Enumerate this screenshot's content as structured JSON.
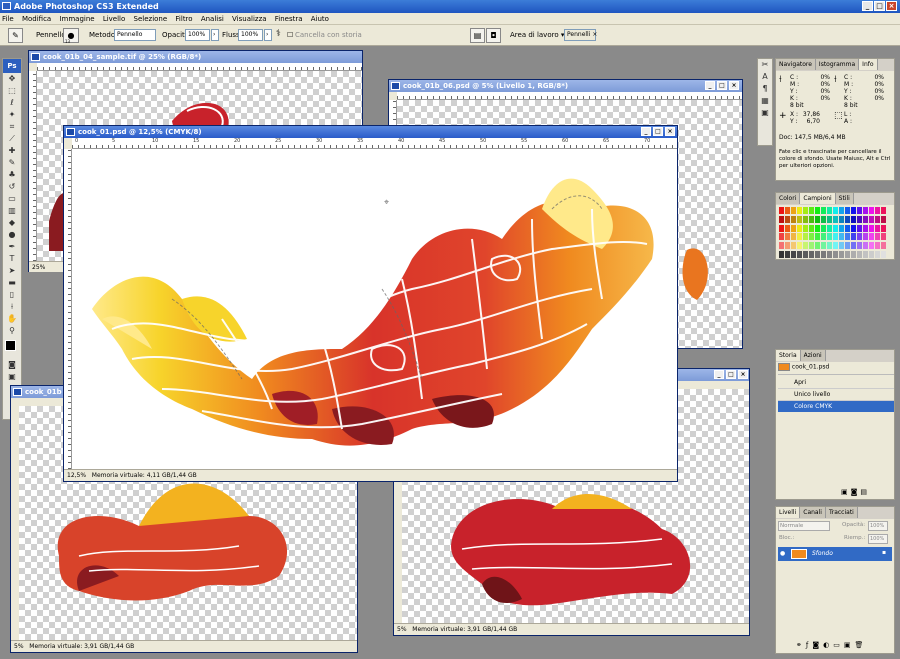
{
  "app": {
    "title": "Adobe Photoshop CS3 Extended"
  },
  "menu": [
    "File",
    "Modifica",
    "Immagine",
    "Livello",
    "Selezione",
    "Filtro",
    "Analisi",
    "Visualizza",
    "Finestra",
    "Aiuto"
  ],
  "options": {
    "brush_label": "Pennello:",
    "brush_size": "13",
    "method_label": "Metodo:",
    "method_value": "Pennello",
    "opacity_label": "Opacità:",
    "opacity_value": "100%",
    "flow_label": "Flusso:",
    "flow_value": "100%",
    "erase_history": "Cancella con storia",
    "workspace": "Area di lavoro",
    "brushes_tab": "Pennelli"
  },
  "documents": [
    {
      "title": "cook_01b_04_sample.tif @ 25% (RGB/8*)",
      "zoom": "25%"
    },
    {
      "title": "cook_01b_06.psd @ 5% (Livello 1, RGB/8*)",
      "zoom": ""
    },
    {
      "title": "cook_01.psd @ 12,5% (CMYK/8)",
      "zoom": "12,5%",
      "status": "Memoria virtuale: 4,11 GB/1,44 GB"
    },
    {
      "title": "cook_01b",
      "zoom": "5%",
      "status": "Memoria virtuale: 3,91 GB/1,44 GB"
    },
    {
      "title": "",
      "zoom": "5%",
      "status": "Memoria virtuale: 3,91 GB/1,44 GB"
    }
  ],
  "ruler_marks": [
    "0",
    "5",
    "10",
    "15",
    "20",
    "25",
    "30",
    "35",
    "40",
    "45",
    "50",
    "55",
    "60",
    "65",
    "70"
  ],
  "info_panel": {
    "tabs": [
      "Navigatore",
      "Istogramma",
      "Info"
    ],
    "cmyk_left": [
      [
        "C :",
        "0%"
      ],
      [
        "M :",
        "0%"
      ],
      [
        "Y :",
        "0%"
      ],
      [
        "K :",
        "0%"
      ]
    ],
    "cmyk_right": [
      [
        "C :",
        "0%"
      ],
      [
        "M :",
        "0%"
      ],
      [
        "Y :",
        "0%"
      ],
      [
        "K :",
        "0%"
      ]
    ],
    "bits_left": "8 bit",
    "bits_right": "8 bit",
    "x_label": "X :",
    "x_value": "37,86",
    "y_label": "Y :",
    "y_value": "6,70",
    "w_label": "L :",
    "h_label": "A :",
    "doc_size": "Doc: 147,5 MB/6,4 MB",
    "hint": "Fate clic e trascinate per cancellare il colore di sfondo. Usate Maiusc, Alt e Ctrl per ulteriori opzioni."
  },
  "swatches_panel": {
    "tabs": [
      "Colori",
      "Campioni",
      "Stili"
    ]
  },
  "history_panel": {
    "tabs": [
      "Storia",
      "Azioni"
    ],
    "snapshot": "cook_01.psd",
    "items": [
      "Apri",
      "Unico livello",
      "Colore CMYK"
    ]
  },
  "layers_panel": {
    "tabs": [
      "Livelli",
      "Canali",
      "Tracciati"
    ],
    "blend_mode": "Normale",
    "opacity_label": "Opacità:",
    "opacity_value": "100%",
    "lock_label": "Bloc.:",
    "fill_label": "Riemp.:",
    "fill_value": "100%",
    "layer_name": "Sfondo"
  },
  "colors": {
    "accent": "#316ac5",
    "title_blue": "#2a5bc9",
    "chrome": "#ece9d8"
  }
}
